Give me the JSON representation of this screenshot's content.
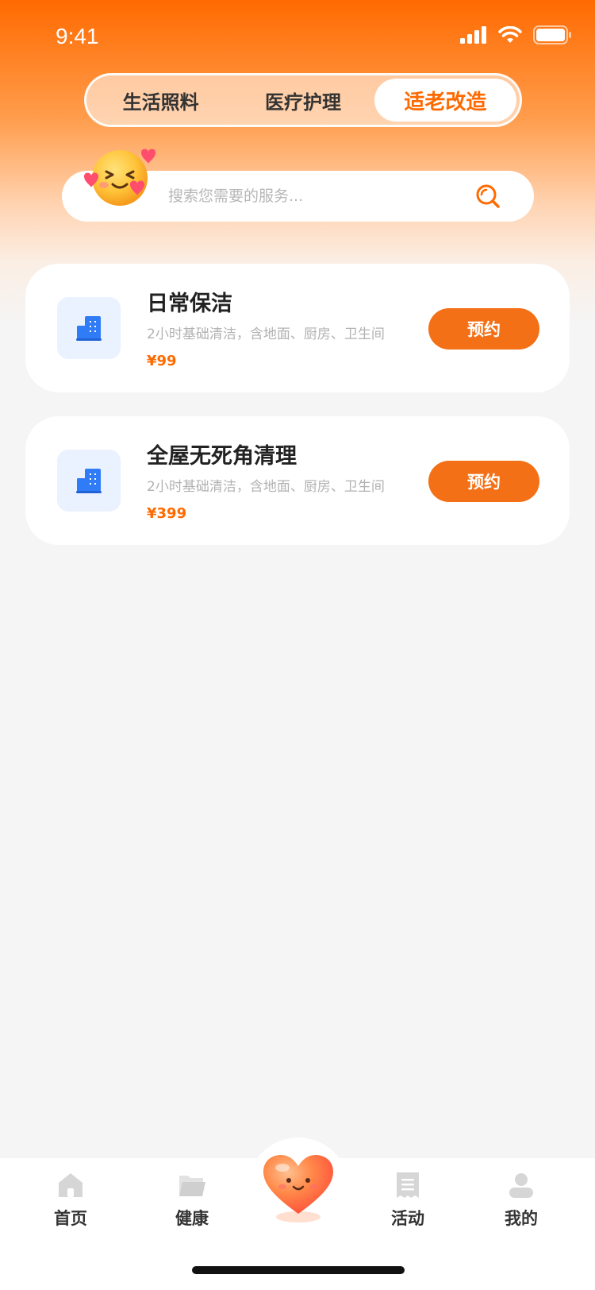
{
  "status_bar": {
    "time": "9:41"
  },
  "tabs": [
    {
      "label": "生活照料",
      "active": false
    },
    {
      "label": "医疗护理",
      "active": false
    },
    {
      "label": "适老改造",
      "active": true
    }
  ],
  "search": {
    "placeholder": "搜索您需要的服务..."
  },
  "services": [
    {
      "title": "日常保洁",
      "desc": "2小时基础清洁，含地面、厨房、卫生间",
      "price": "¥99",
      "action": "预约",
      "icon": "building-icon"
    },
    {
      "title": "全屋无死角清理",
      "desc": "2小时基础清洁，含地面、厨房、卫生间",
      "price": "¥399",
      "action": "预约",
      "icon": "building-icon"
    }
  ],
  "nav": {
    "home": "首页",
    "health": "健康",
    "activity": "活动",
    "mine": "我的"
  },
  "colors": {
    "accent": "#ff6a00",
    "button": "#f47016",
    "icon_blue": "#2f7cf6",
    "nav_icon": "#d6d6d6"
  }
}
